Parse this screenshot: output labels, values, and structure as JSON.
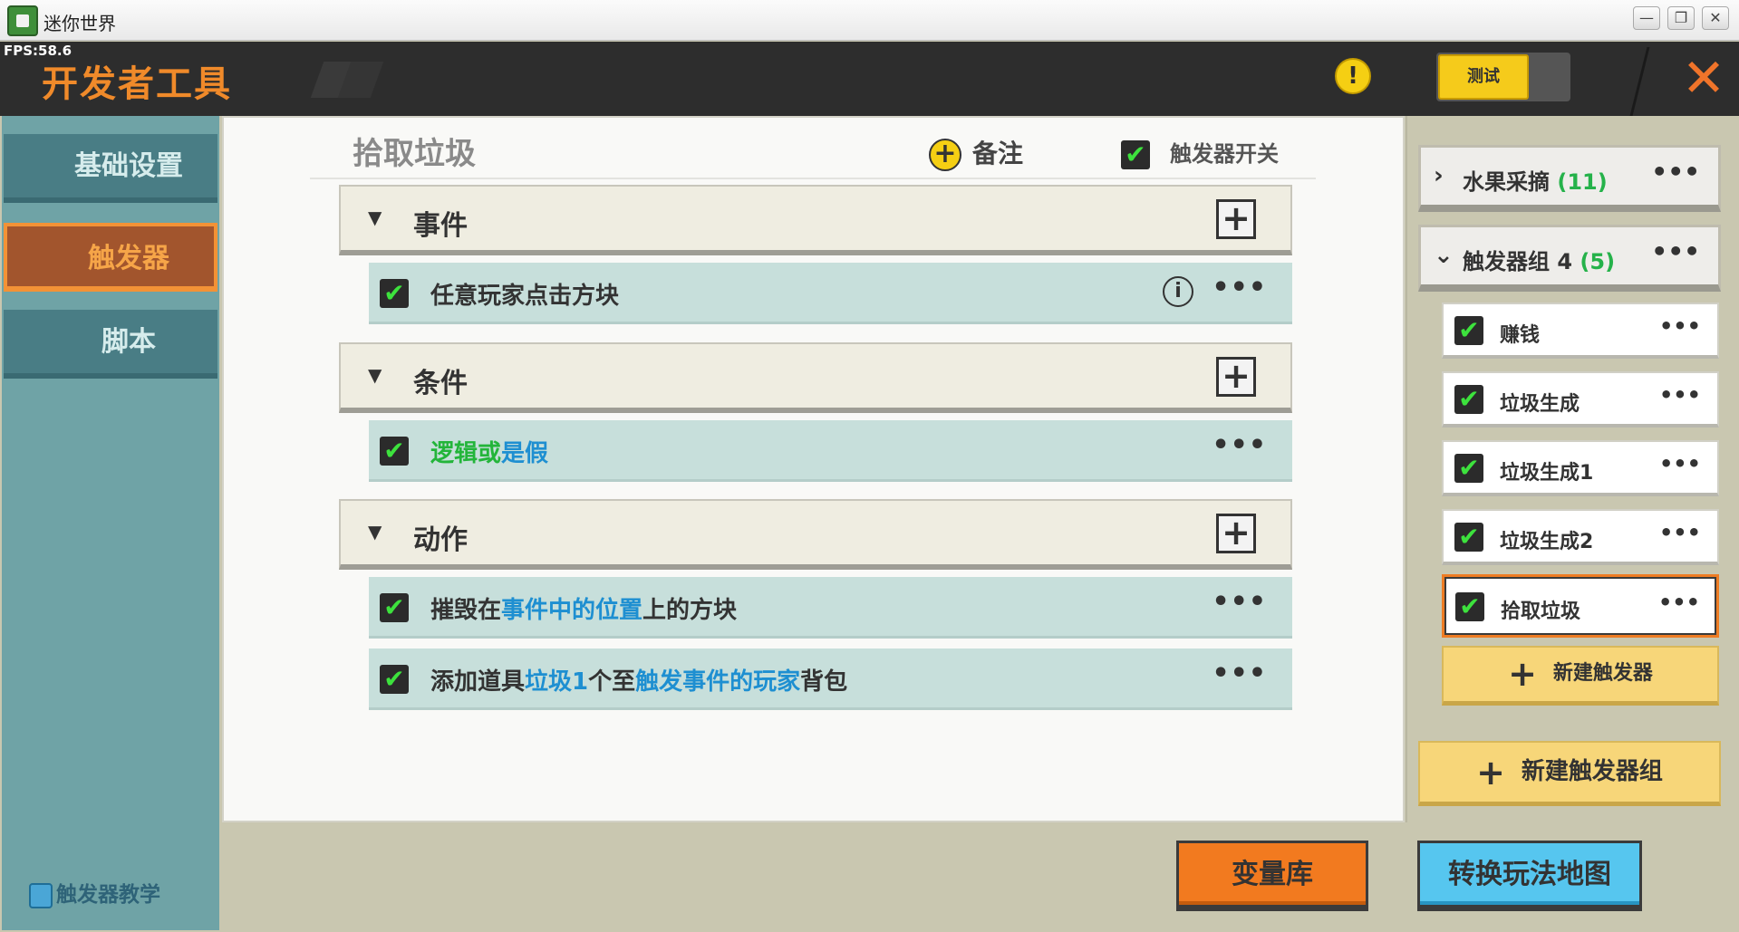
{
  "window": {
    "title": "迷你世界",
    "fps": "FPS:58.6"
  },
  "header": {
    "title": "开发者工具",
    "test_label": "测试",
    "warning_symbol": "!",
    "close_symbol": "✕"
  },
  "sidebar": {
    "items": [
      {
        "label": "基础设置",
        "active": false
      },
      {
        "label": "触发器",
        "active": true
      },
      {
        "label": "脚本",
        "active": false
      }
    ],
    "tutorial": "触发器教学"
  },
  "editor": {
    "trigger_name": "拾取垃圾",
    "note_label": "备注",
    "switch_label": "触发器开关",
    "switch_checked": true,
    "sections": {
      "event": {
        "title": "事件",
        "rows": [
          {
            "text": "任意玩家点击方块",
            "checked": true,
            "has_info": true
          }
        ]
      },
      "condition": {
        "title": "条件",
        "rows": [
          {
            "parts": [
              {
                "t": "逻辑或",
                "style": "green"
              },
              {
                "t": "是假",
                "style": "hl"
              }
            ],
            "checked": true
          }
        ]
      },
      "action": {
        "title": "动作",
        "rows": [
          {
            "parts": [
              {
                "t": "摧毁在",
                "style": ""
              },
              {
                "t": "事件中的位置",
                "style": "hl"
              },
              {
                "t": "上的方块",
                "style": ""
              }
            ],
            "checked": true
          },
          {
            "parts": [
              {
                "t": "添加道具",
                "style": ""
              },
              {
                "t": "垃圾1",
                "style": "hl"
              },
              {
                "t": "个至",
                "style": ""
              },
              {
                "t": "触发事件的玩家",
                "style": "hl"
              },
              {
                "t": "背包",
                "style": ""
              }
            ],
            "checked": true
          }
        ]
      }
    }
  },
  "right_panel": {
    "groups": [
      {
        "title": "水果采摘",
        "count": "(11)",
        "expanded": false
      },
      {
        "title": "触发器组 4",
        "count": "(5)",
        "expanded": true
      }
    ],
    "triggers": [
      {
        "label": "赚钱",
        "active": false
      },
      {
        "label": "垃圾生成",
        "active": false
      },
      {
        "label": "垃圾生成1",
        "active": false
      },
      {
        "label": "垃圾生成2",
        "active": false
      },
      {
        "label": "拾取垃圾",
        "active": true
      }
    ],
    "new_trigger": "新建触发器",
    "new_group": "新建触发器组"
  },
  "bottom": {
    "variables_button": "变量库",
    "convert_button": "转换玩法地图"
  },
  "colors": {
    "accent_orange": "#f27a1f",
    "accent_blue": "#56c6ef",
    "highlight_blue": "#1e8fd1",
    "highlight_green": "#23b53a",
    "check_green": "#3de23d"
  }
}
